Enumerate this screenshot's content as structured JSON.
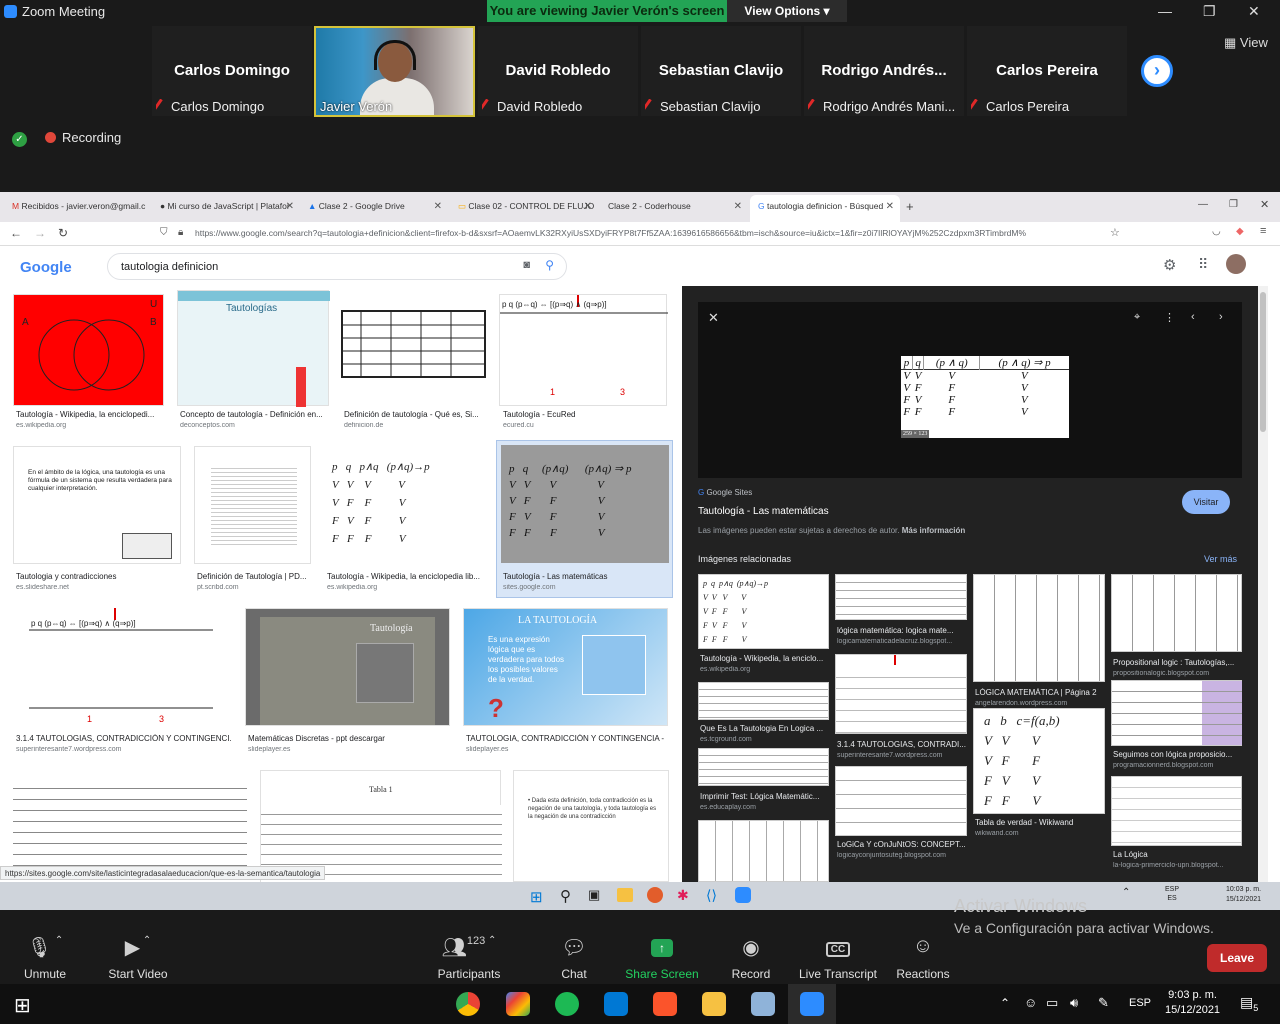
{
  "zoom": {
    "window_title": "Zoom Meeting",
    "share_banner": "You are viewing Javier Verón's screen",
    "view_options": "View Options ▾",
    "view_label": "View",
    "recording": "Recording",
    "participants": [
      {
        "name": "Carlos Domingo",
        "label": "Carlos Domingo"
      },
      {
        "name": "",
        "label": "Javier Verón"
      },
      {
        "name": "David Robledo",
        "label": "David Robledo"
      },
      {
        "name": "Sebastian Clavijo",
        "label": "Sebastian Clavijo"
      },
      {
        "name": "Rodrigo  Andrés...",
        "label": "Rodrigo Andrés Mani..."
      },
      {
        "name": "Carlos Pereira",
        "label": "Carlos Pereira"
      }
    ],
    "toolbar": {
      "unmute": "Unmute",
      "start_video": "Start Video",
      "participants": "Participants",
      "participants_count": "123",
      "chat": "Chat",
      "share_screen": "Share Screen",
      "record": "Record",
      "live_transcript": "Live Transcript",
      "reactions": "Reactions",
      "leave": "Leave"
    }
  },
  "browser": {
    "tabs": [
      "Recibidos - javier.veron@gmail.c",
      "Mi curso de JavaScript | Platafor",
      "Clase 2 - Google Drive",
      "Clase 02 - CONTROL DE FLUJO",
      "Clase 2 - Coderhouse",
      "tautologia definicion - Búsqued"
    ],
    "url": "https://www.google.com/search?q=tautologia+definicion&client=firefox-b-d&sxsrf=AOaemvLK32RXyiUsSXDyiFRYP8t7Ff5ZAA:1639616586656&tbm=isch&source=iu&ictx=1&fir=z0i7IlRlOYAYjM%252Czdpxm3RTimbrdM%",
    "google_logo": "Google",
    "search_query": "tautologia definicion",
    "status_url": "https://sites.google.com/site/lasticintegradasalaeducacion/que-es-la-semantica/tautologia",
    "results": [
      {
        "caption": "Tautología - Wikipedia, la enciclopedi...",
        "source": "es.wikipedia.org"
      },
      {
        "caption": "Concepto de tautología - Definición en...",
        "source": "deconceptos.com"
      },
      {
        "caption": "Definición de tautología - Qué es, Si...",
        "source": "definicion.de"
      },
      {
        "caption": "Tautología - EcuRed",
        "source": "ecured.cu"
      },
      {
        "caption": "Tautologia y contradicciones",
        "source": "es.slideshare.net"
      },
      {
        "caption": "Definición de Tautología | PD...",
        "source": "pt.scribd.com"
      },
      {
        "caption": "Tautología - Wikipedia, la enciclopedia lib...",
        "source": "es.wikipedia.org"
      },
      {
        "caption": "Tautología - Las matemáticas",
        "source": "sites.google.com"
      },
      {
        "caption": "3.1.4 TAUTOLOGIAS, CONTRADICCIÓN Y CONTINGENCI...",
        "source": "superinteresante7.wordpress.com"
      },
      {
        "caption": "Matemáticas Discretas - ppt descargar",
        "source": "slideplayer.es"
      },
      {
        "caption": "TAUTOLOGIA, CONTRADICCIÓN Y CONTINGENCIA - ...",
        "source": "slideplayer.es"
      }
    ],
    "panel": {
      "site_label": "Google Sites",
      "title": "Tautología - Las matemáticas",
      "copyright": "Las imágenes pueden estar sujetas a derechos de autor.",
      "more_info": "Más información",
      "visit": "Visitar",
      "related": "Imágenes relacionadas",
      "see_more": "Ver más",
      "size_badge": "259 × 123",
      "related_items": [
        {
          "caption": "Tautología - Wikipedia, la enciclo...",
          "source": "es.wikipedia.org"
        },
        {
          "caption": "lógica matemática: logica mate...",
          "source": "logicamatematicadelacruz.blogspot..."
        },
        {
          "caption": "LÓGICA MATEMÁTICA | Página 2",
          "source": "angelarendon.wordpress.com"
        },
        {
          "caption": "Propositional logic : Tautologías,...",
          "source": "propositionalogic.blogspot.com"
        },
        {
          "caption": "Que Es La Tautologia En Logica ...",
          "source": "es.tcground.com"
        },
        {
          "caption": "3.1.4 TAUTOLOGIAS, CONTRADI...",
          "source": "superinteresante7.wordpress.com"
        },
        {
          "caption": "Tabla de verdad - Wikiwand",
          "source": "wikiwand.com"
        },
        {
          "caption": "Seguimos con lógica proposicio...",
          "source": "programacionnerd.blogspot.com"
        },
        {
          "caption": "Imprimir Test: Lógica Matemátic...",
          "source": "es.educaplay.com"
        },
        {
          "caption": "LoGiCa Y cOnJuNtOS: CONCEPT...",
          "source": "logicayconjuntosuteg.blogspot.com"
        },
        {
          "caption": "La Lógica",
          "source": "la-logica-primerciclo-upn.blogspot..."
        }
      ]
    },
    "truth_table_headers": [
      "p",
      "q",
      "(p ∧ q)",
      "(p ∧ q) ⇒ p"
    ],
    "truth_table_rows": [
      [
        "V",
        "V",
        "V",
        "V"
      ],
      [
        "V",
        "F",
        "F",
        "V"
      ],
      [
        "F",
        "V",
        "F",
        "V"
      ],
      [
        "F",
        "F",
        "F",
        "V"
      ]
    ]
  },
  "shared_taskbar": {
    "lang": "ESP",
    "lang2": "ES",
    "time": "10:03 p. m.",
    "date": "15/12/2021"
  },
  "activation": {
    "line1": "Activar Windows",
    "line2": "Ve a Configuración para activar Windows."
  },
  "taskbar": {
    "lang": "ESP",
    "time": "9:03 p. m.",
    "date": "15/12/2021",
    "notif_count": "5"
  },
  "colors": {
    "share_green": "#23a455",
    "zoom_blue": "#2d8cff",
    "leave_red": "#c02b2b"
  }
}
